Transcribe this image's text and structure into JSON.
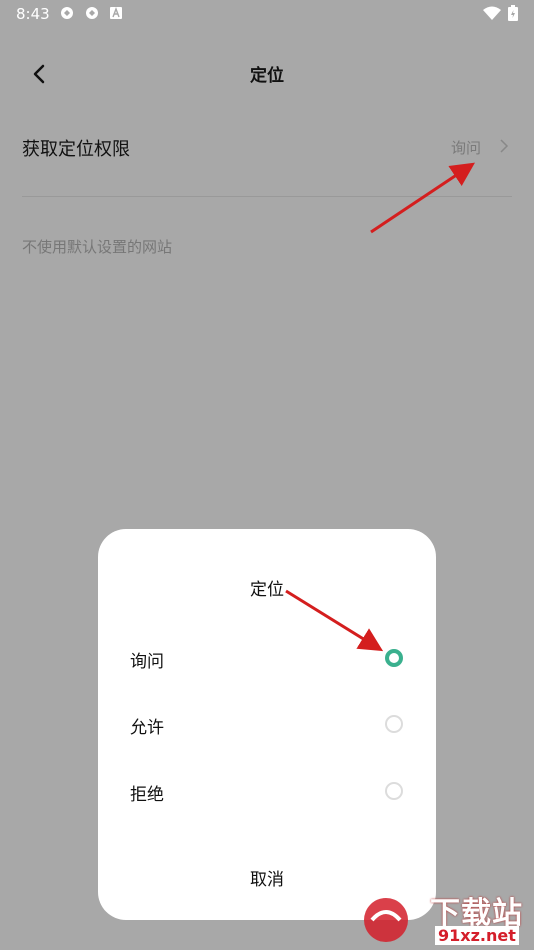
{
  "status_bar": {
    "time": "8:43",
    "icons": [
      "sync-icon",
      "sync-icon",
      "text-a-icon",
      "wifi-icon",
      "battery-icon"
    ]
  },
  "header": {
    "back_icon": "chevron-left-icon",
    "title": "定位"
  },
  "permission_row": {
    "label": "获取定位权限",
    "value": "询问",
    "chevron_icon": "chevron-right-icon"
  },
  "section": {
    "label": "不使用默认设置的网站"
  },
  "dialog": {
    "title": "定位",
    "options": [
      {
        "label": "询问",
        "selected": true
      },
      {
        "label": "允许",
        "selected": false
      },
      {
        "label": "拒绝",
        "selected": false
      }
    ],
    "cancel_label": "取消"
  },
  "watermark": {
    "text_cn": "下载站",
    "text_url": "91xz.net"
  },
  "colors": {
    "scrim": "#a8a8a8",
    "accent": "#3ab08e",
    "annotation_arrow": "#d41e1e"
  }
}
